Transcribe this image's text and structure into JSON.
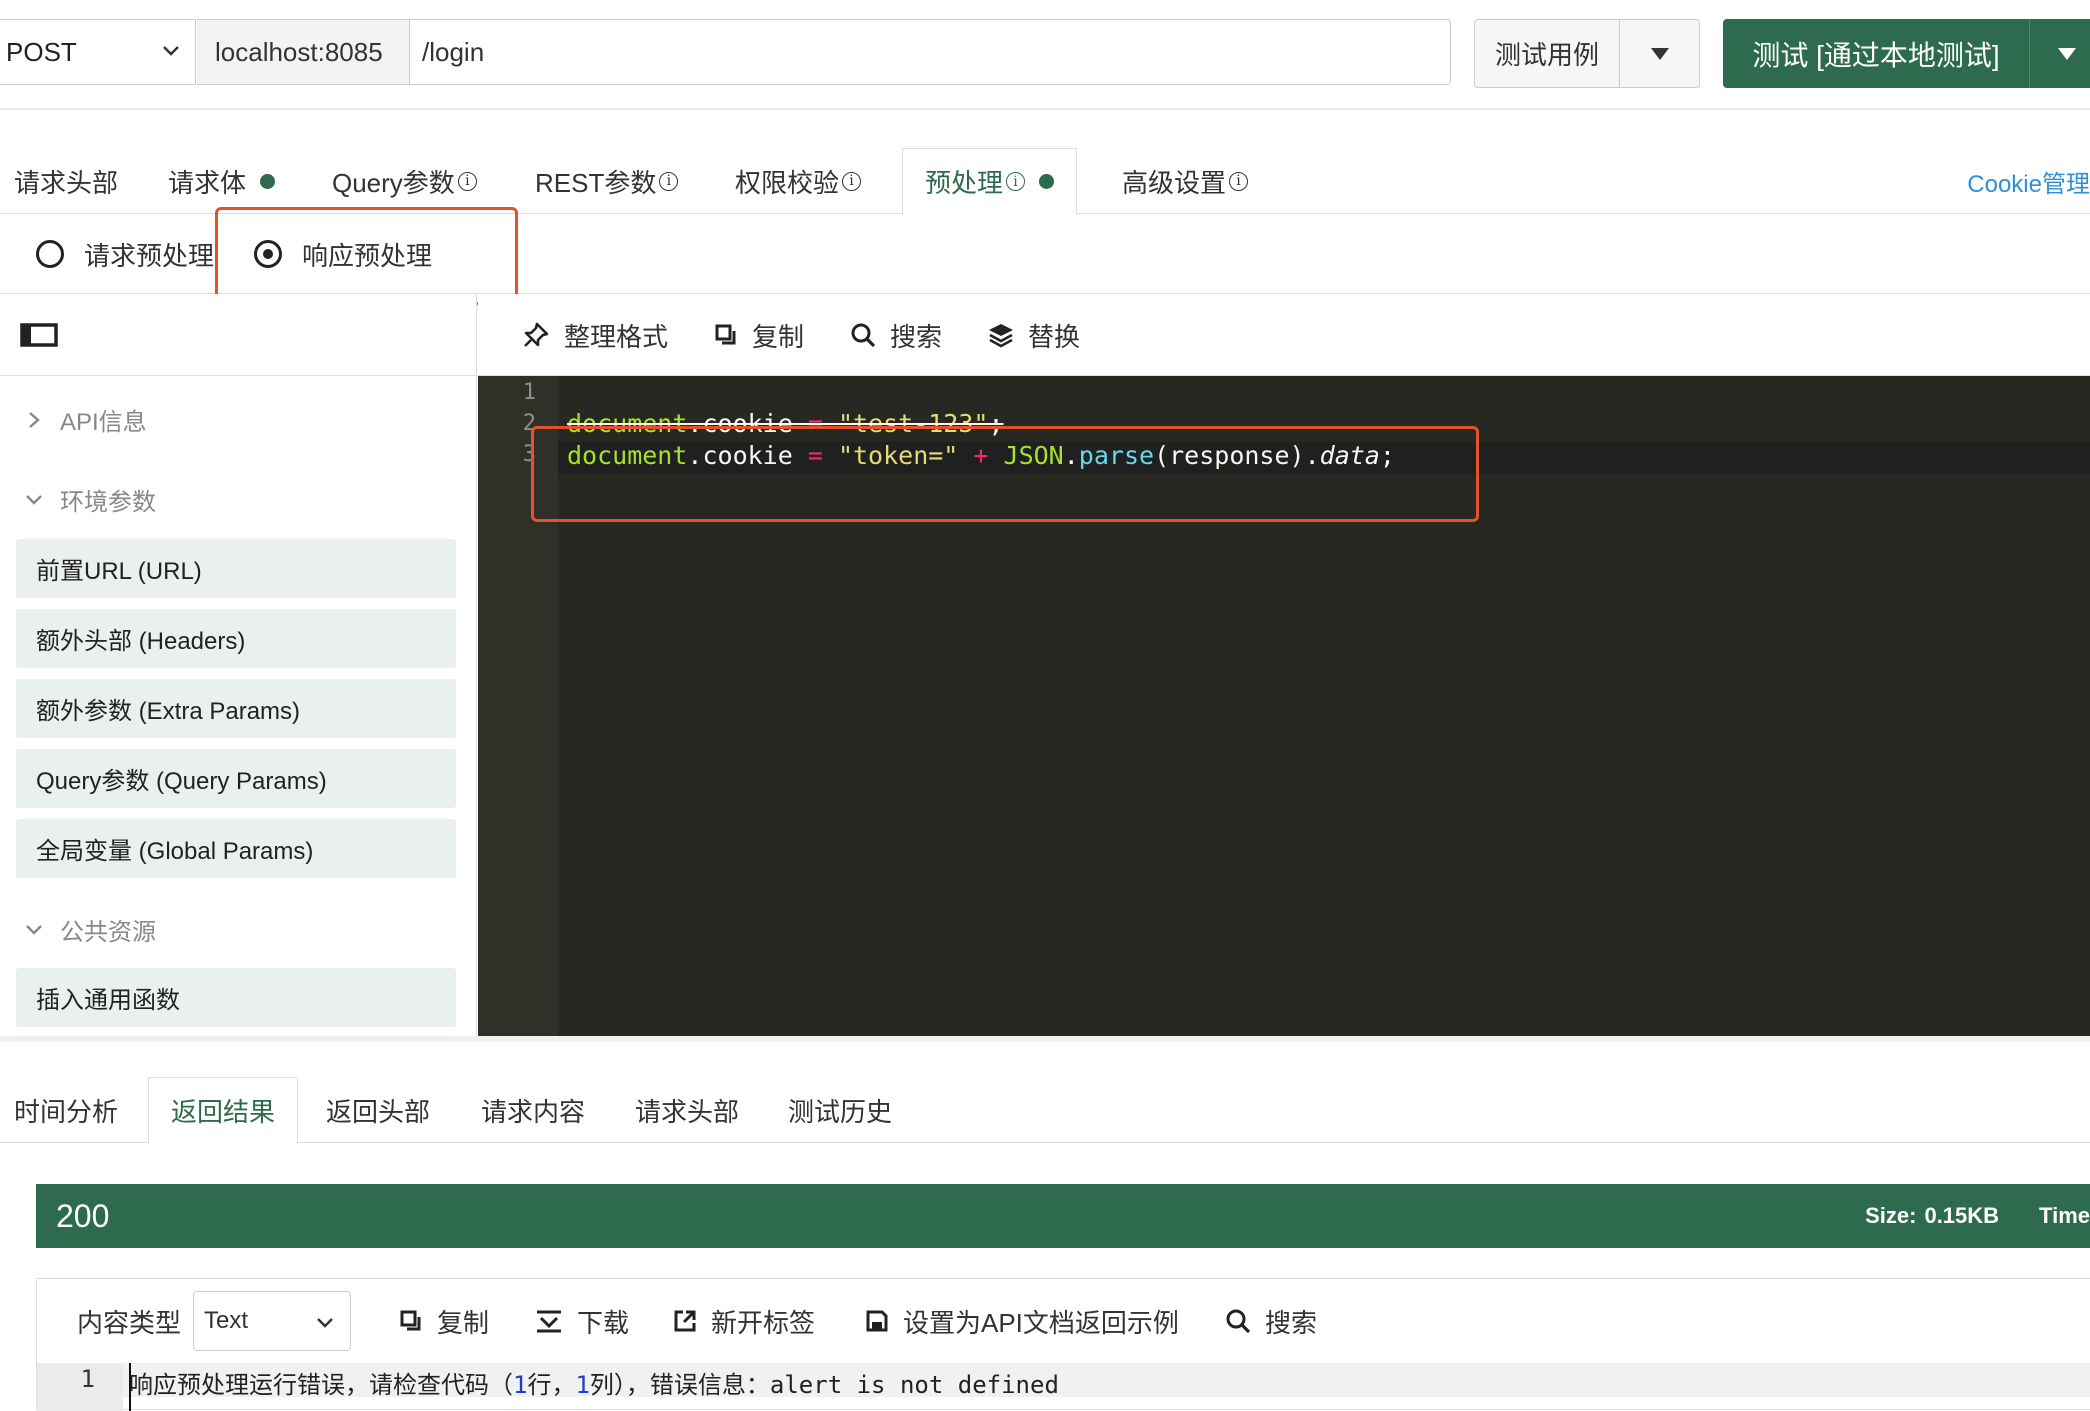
{
  "request": {
    "method": "POST",
    "host": "localhost:8085",
    "path": "/login",
    "case_button": "测试用例",
    "test_button": "测试 [通过本地测试]"
  },
  "tabs": [
    {
      "label": "请求头部"
    },
    {
      "label": "请求体"
    },
    {
      "label": "Query参数"
    },
    {
      "label": "REST参数"
    },
    {
      "label": "权限校验"
    },
    {
      "label": "预处理"
    },
    {
      "label": "高级设置"
    }
  ],
  "cookie_link": "Cookie管理",
  "radios": [
    {
      "label": "请求预处理",
      "selected": false
    },
    {
      "label": "响应预处理",
      "selected": true
    }
  ],
  "sidebar": {
    "sections": [
      {
        "label": "API信息",
        "expanded": false
      },
      {
        "label": "环境参数",
        "expanded": true
      },
      {
        "label": "公共资源",
        "expanded": true
      }
    ],
    "env_items": [
      "前置URL (URL)",
      "额外头部 (Headers)",
      "额外参数 (Extra Params)",
      "Query参数 (Query Params)",
      "全局变量 (Global Params)"
    ],
    "public_items": [
      "插入通用函数"
    ]
  },
  "editor_toolbar": {
    "format": "整理格式",
    "copy": "复制",
    "search": "搜索",
    "replace": "替换"
  },
  "code": {
    "line_numbers": [
      "1",
      "2",
      "3"
    ],
    "line2": {
      "obj": "document",
      "prop": ".cookie",
      "op": " = ",
      "str": "\"test-123\"",
      "end": ";"
    },
    "line3": {
      "obj": "document",
      "prop": ".cookie",
      "op": " = ",
      "str": "\"token=\"",
      "plus": " + ",
      "json": "JSON",
      "dot": ".",
      "parse": "parse",
      "args": "(response).",
      "data": "data",
      "end": ";"
    }
  },
  "response_tabs": [
    "时间分析",
    "返回结果",
    "返回头部",
    "请求内容",
    "请求头部",
    "测试历史"
  ],
  "status": {
    "code": "200",
    "size_label": "Size:",
    "size_value": "0.15KB",
    "time_label": "Time"
  },
  "response_toolbar": {
    "content_type_label": "内容类型",
    "content_type_value": "Text",
    "copy": "复制",
    "download": "下载",
    "new_tab": "新开标签",
    "set_example": "设置为API文档返回示例",
    "search": "搜索"
  },
  "output": {
    "line_number": "1",
    "seg1": "响应预处理运行错误，请检查代码（",
    "num1": "1",
    "seg2": "行，",
    "num2": "1",
    "seg3": "列），错误信息：alert is not defined"
  },
  "colors": {
    "brand_green": "#2e6b4e",
    "highlight_red": "#e6512b",
    "link_blue": "#2f8fd8",
    "editor_bg": "#272822"
  }
}
